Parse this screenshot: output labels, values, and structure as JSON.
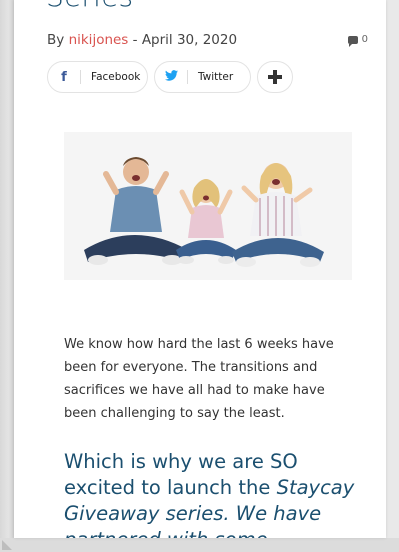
{
  "article": {
    "title_partial": "Series",
    "byline_prefix": "By",
    "author": "nikijones",
    "byline_separator": "-",
    "date": "April 30, 2020",
    "comment_count": "0"
  },
  "share": {
    "facebook_label": "Facebook",
    "twitter_label": "Twitter",
    "facebook_icon": "f",
    "twitter_icon": "🐦"
  },
  "content": {
    "intro_paragraph": "We know how hard the last 6 weeks have been for everyone. The transitions and sacrifices we have all had to make have been challenging to say the least.",
    "headline_plain": "Which is why we are SO excited to launch the ",
    "headline_italic": "Staycay Giveaway series. We have partnered with some"
  },
  "colors": {
    "title": "#1b4f6f",
    "author_link": "#d9534f",
    "facebook": "#3b5998",
    "twitter": "#1da1f2"
  }
}
